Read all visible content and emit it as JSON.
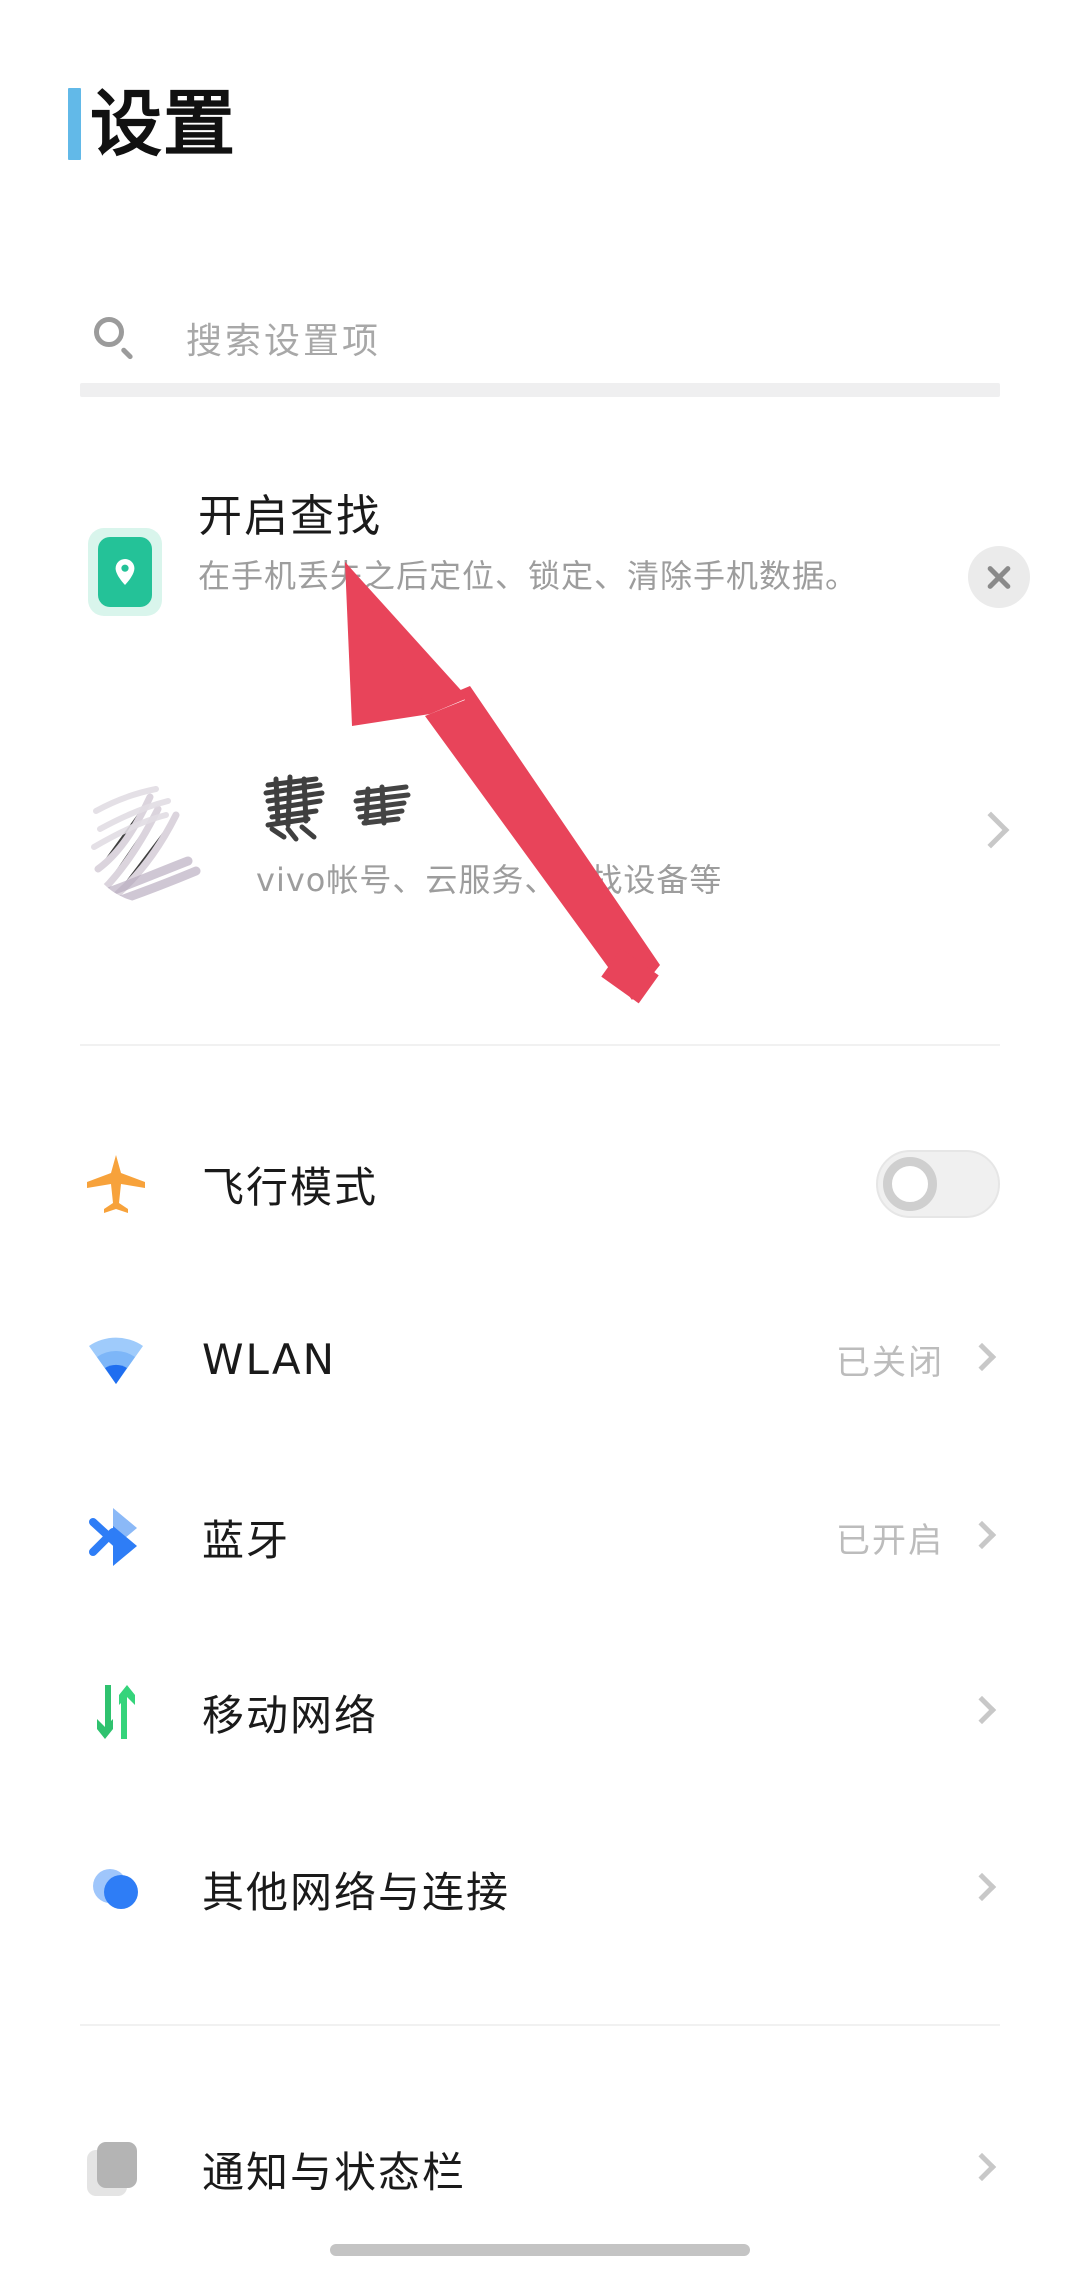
{
  "header": {
    "title": "设置",
    "accent_color": "#62b9e8"
  },
  "search": {
    "placeholder": "搜索设置项",
    "icon": "search-icon",
    "value": ""
  },
  "promo_card": {
    "icon": "find-my-phone-icon",
    "icon_color": "#24c298",
    "title": "开启查找",
    "description": "在手机丢失之后定位、锁定、清除手机数据。",
    "close_icon": "close-icon"
  },
  "account": {
    "avatar": "avatar-redacted",
    "name": "",
    "subtitle": "vivo帐号、云服务、查找设备等",
    "chevron": "chevron-right-icon"
  },
  "settings": [
    {
      "label": "飞行模式",
      "icon": "airplane-icon",
      "icon_color": "#f7a23b",
      "control": "toggle",
      "toggle_on": false,
      "status": ""
    },
    {
      "label": "WLAN",
      "icon": "wifi-icon",
      "icon_color": "#2e7df6",
      "control": "chevron",
      "status": "已关闭"
    },
    {
      "label": "蓝牙",
      "icon": "bluetooth-icon",
      "icon_color": "#2e7df6",
      "control": "chevron",
      "status": "已开启"
    },
    {
      "label": "移动网络",
      "icon": "mobile-data-icon",
      "icon_color": "#2ecc71",
      "control": "chevron",
      "status": ""
    },
    {
      "label": "其他网络与连接",
      "icon": "other-network-icon",
      "icon_color": "#2e7df6",
      "control": "chevron",
      "status": ""
    }
  ],
  "settings_group_2": [
    {
      "label": "通知与状态栏",
      "icon": "notification-bar-icon",
      "icon_color": "#b0b0b0",
      "control": "chevron",
      "status": ""
    }
  ],
  "annotation": {
    "type": "arrow",
    "color": "#e8445a",
    "points_to": "开启查找"
  }
}
